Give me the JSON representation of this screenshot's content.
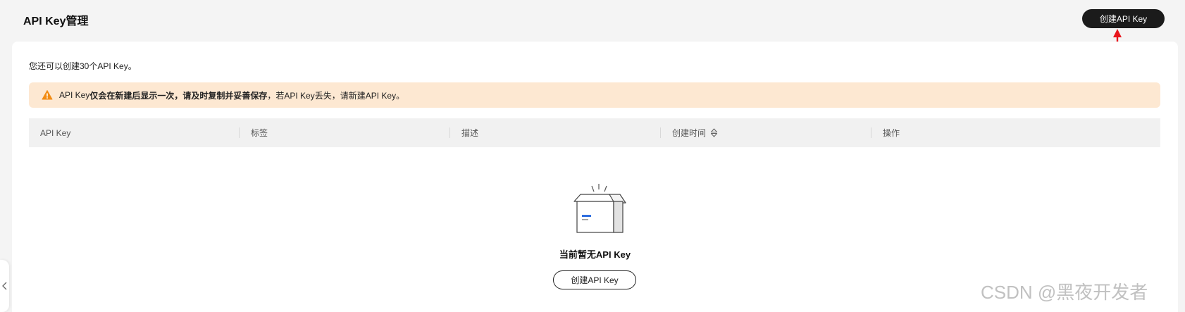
{
  "header": {
    "title": "API Key管理",
    "create_button": "创建API Key"
  },
  "info": {
    "remaining": "您还可以创建30个API Key。"
  },
  "warning": {
    "prefix": "API Key",
    "bold": "仅会在新建后显示一次，请及时复制并妥善保存",
    "suffix": "，若API Key丢失，请新建API Key。"
  },
  "table": {
    "columns": [
      "API Key",
      "标签",
      "描述",
      "创建时间",
      "操作"
    ]
  },
  "empty": {
    "text": "当前暂无API Key",
    "button": "创建API Key"
  },
  "watermark": "CSDN @黑夜开发者",
  "colors": {
    "primary_button": "#1b1b1b",
    "warning_bg": "#fde8d2",
    "warning_icon": "#f28c14",
    "annotation_arrow": "#e8141b",
    "illustration_accent": "#2f6fe0"
  },
  "icons": {
    "warning": "warning-triangle-icon",
    "sort": "sort-icon",
    "collapse": "chevron-left-icon"
  }
}
